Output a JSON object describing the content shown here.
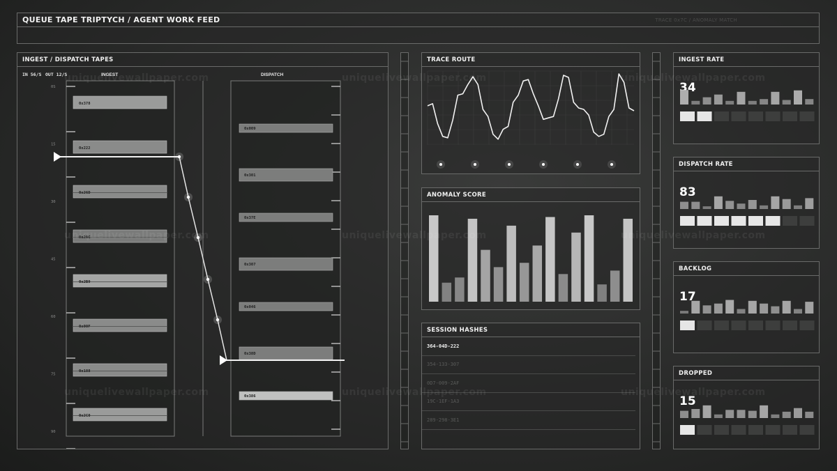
{
  "header": {
    "title": "QUEUE TAPE TRIPTYCH / AGENT WORK FEED",
    "trace_tag": "TRACE 0x7C / ANOMALY MATCH"
  },
  "watermark": "uniquelivewallpaper.com",
  "tapes": {
    "title": "INGEST / DISPATCH TAPES",
    "rate_in": "IN 56/S",
    "rate_out": "OUT 12/S",
    "ingest_label": "INGEST",
    "dispatch_label": "DISPATCH",
    "scale": [
      "0S",
      "15",
      "30",
      "45",
      "60",
      "75",
      "90"
    ],
    "ingest_items": [
      "0x378",
      "0x222",
      "0x26D",
      "0x2AC",
      "0x2B9",
      "0x00F",
      "0x188",
      "0x2C0"
    ],
    "dispatch_items": [
      "0x009",
      "0x301",
      "0x37E",
      "0x307",
      "0x046",
      "0x38D",
      "0x386"
    ]
  },
  "trace_route": {
    "title": "TRACE ROUTE",
    "points": [
      55,
      58,
      30,
      12,
      10,
      35,
      70,
      72,
      85,
      96,
      85,
      50,
      40,
      15,
      8,
      22,
      26,
      60,
      70,
      90,
      92,
      72,
      55,
      36,
      38,
      40,
      65,
      98,
      95,
      60,
      52,
      50,
      42,
      18,
      12,
      15,
      40,
      50,
      100,
      88,
      52,
      48
    ]
  },
  "anomaly_score": {
    "title": "ANOMALY SCORE",
    "values": [
      100,
      22,
      28,
      96,
      60,
      40,
      88,
      45,
      65,
      98,
      32,
      80,
      100,
      20,
      36,
      96
    ]
  },
  "sessions": {
    "title": "SESSION HASHES",
    "rows": [
      "364-04D-222",
      "354-133-307",
      "0D7-009-2AF",
      "19C-1EF-1A3",
      "289-298-3E1"
    ]
  },
  "metrics": [
    {
      "title": "INGEST RATE",
      "value": "34",
      "bars": [
        80,
        20,
        40,
        55,
        20,
        70,
        20,
        30,
        70,
        25,
        78,
        30
      ],
      "lit": 2
    },
    {
      "title": "DISPATCH RATE",
      "value": "83",
      "bars": [
        40,
        40,
        15,
        70,
        45,
        30,
        50,
        20,
        70,
        55,
        20,
        60
      ],
      "lit": 6
    },
    {
      "title": "BACKLOG",
      "value": "17",
      "bars": [
        15,
        70,
        45,
        55,
        75,
        25,
        70,
        55,
        40,
        70,
        25,
        65
      ],
      "lit": 1
    },
    {
      "title": "DROPPED",
      "value": "15",
      "bars": [
        40,
        50,
        70,
        20,
        45,
        45,
        40,
        70,
        20,
        35,
        55,
        35
      ],
      "lit": 1
    }
  ]
}
